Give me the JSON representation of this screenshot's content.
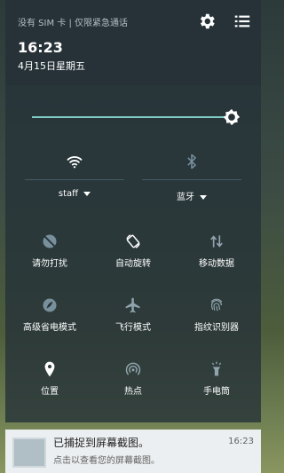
{
  "status": {
    "text": "没有 SIM 卡 | 仅限紧急通话"
  },
  "clock": {
    "time": "16:23",
    "date": "4月15日星期五"
  },
  "header_icons": {
    "settings": "gear-icon",
    "menu": "list-menu-icon"
  },
  "brightness": {
    "level": 0.95,
    "accent": "#80cbc4"
  },
  "top_tiles": {
    "wifi": {
      "label": "staff",
      "icon": "wifi-icon",
      "active": true
    },
    "bluetooth": {
      "label": "蓝牙",
      "icon": "bluetooth-icon",
      "active": false
    }
  },
  "tiles": [
    {
      "label": "请勿打扰",
      "icon": "do-not-disturb-icon",
      "active": false
    },
    {
      "label": "自动旋转",
      "icon": "auto-rotate-icon",
      "active": true
    },
    {
      "label": "移动数据",
      "icon": "mobile-data-icon",
      "active": false
    },
    {
      "label": "高级省电模式",
      "icon": "battery-saver-icon",
      "active": false
    },
    {
      "label": "飞行模式",
      "icon": "airplane-icon",
      "active": false
    },
    {
      "label": "指纹识别器",
      "icon": "fingerprint-icon",
      "active": false
    },
    {
      "label": "位置",
      "icon": "location-icon",
      "active": true
    },
    {
      "label": "热点",
      "icon": "hotspot-icon",
      "active": false
    },
    {
      "label": "手电筒",
      "icon": "flashlight-icon",
      "active": false
    }
  ],
  "notification": {
    "title": "已捕捉到屏幕截图。",
    "text": "点击以查看您的屏幕截图。",
    "time": "16:23"
  }
}
